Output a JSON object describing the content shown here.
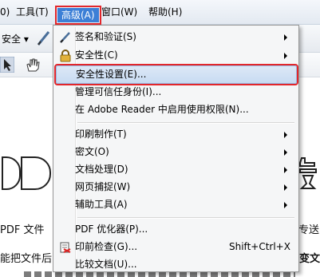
{
  "menubar": {
    "items": [
      "0)",
      "工具(T)",
      "高级(A)",
      "窗口(W)",
      "帮助(H)"
    ]
  },
  "toolbar": {
    "security_label": "安全 ▾"
  },
  "document": {
    "line1": "PDF 文件",
    "line1_right": "专送",
    "line2": "能把文件后",
    "line2_right": "变文"
  },
  "menu": {
    "items": [
      {
        "label": "签名和验证(S)",
        "submenu": true
      },
      {
        "label": "安全性(C)",
        "submenu": true
      },
      {
        "label": "安全性设置(E)...",
        "submenu": false
      },
      {
        "label": "管理可信任身份(I)...",
        "submenu": false
      },
      {
        "label": "在 Adobe Reader 中启用使用权限(N)...",
        "submenu": false
      },
      {
        "label": "印刷制作(T)",
        "submenu": true
      },
      {
        "label": "密文(O)",
        "submenu": true
      },
      {
        "label": "文档处理(D)",
        "submenu": true
      },
      {
        "label": "网页捕捉(W)",
        "submenu": true
      },
      {
        "label": "辅助工具(A)",
        "submenu": true
      },
      {
        "label": "PDF 优化器(P)...",
        "submenu": false
      },
      {
        "label": "印前检查(G)...",
        "shortcut": "Shift+Ctrl+X",
        "submenu": false
      },
      {
        "label": "比较文档(U)...",
        "submenu": false
      }
    ]
  },
  "colors": {
    "highlight_outline": "#e2262b",
    "menubar_active": "#3c7fd6"
  }
}
